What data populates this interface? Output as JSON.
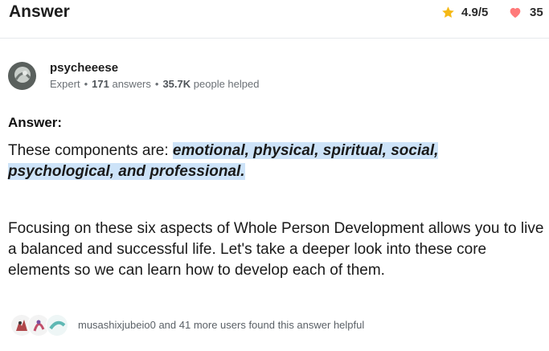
{
  "header": {
    "title": "Answer",
    "rating": "4.9/5",
    "likes": "35",
    "star_icon": "star-icon",
    "heart_icon": "heart-icon",
    "star_color": "#f5b915",
    "heart_color": "#ff7a7a"
  },
  "author": {
    "name": "psycheeese",
    "role": "Expert",
    "answers_count": "171",
    "answers_label": "answers",
    "helped_count": "35.7K",
    "helped_label": "people helped"
  },
  "answer": {
    "label": "Answer:",
    "intro": "These components are: ",
    "highlight": "emotional, physical, spiritual, social, psychological, and professional.",
    "highlight_color": "#cde3f8",
    "paragraph": "Focusing on these six aspects of Whole Person Development allows you to live a balanced and successful life. Let's take a deeper look into these core elements so we can learn how to develop each of them."
  },
  "footer": {
    "helpful_text": "musashixjubeio0 and 41 more users found this answer helpful"
  }
}
